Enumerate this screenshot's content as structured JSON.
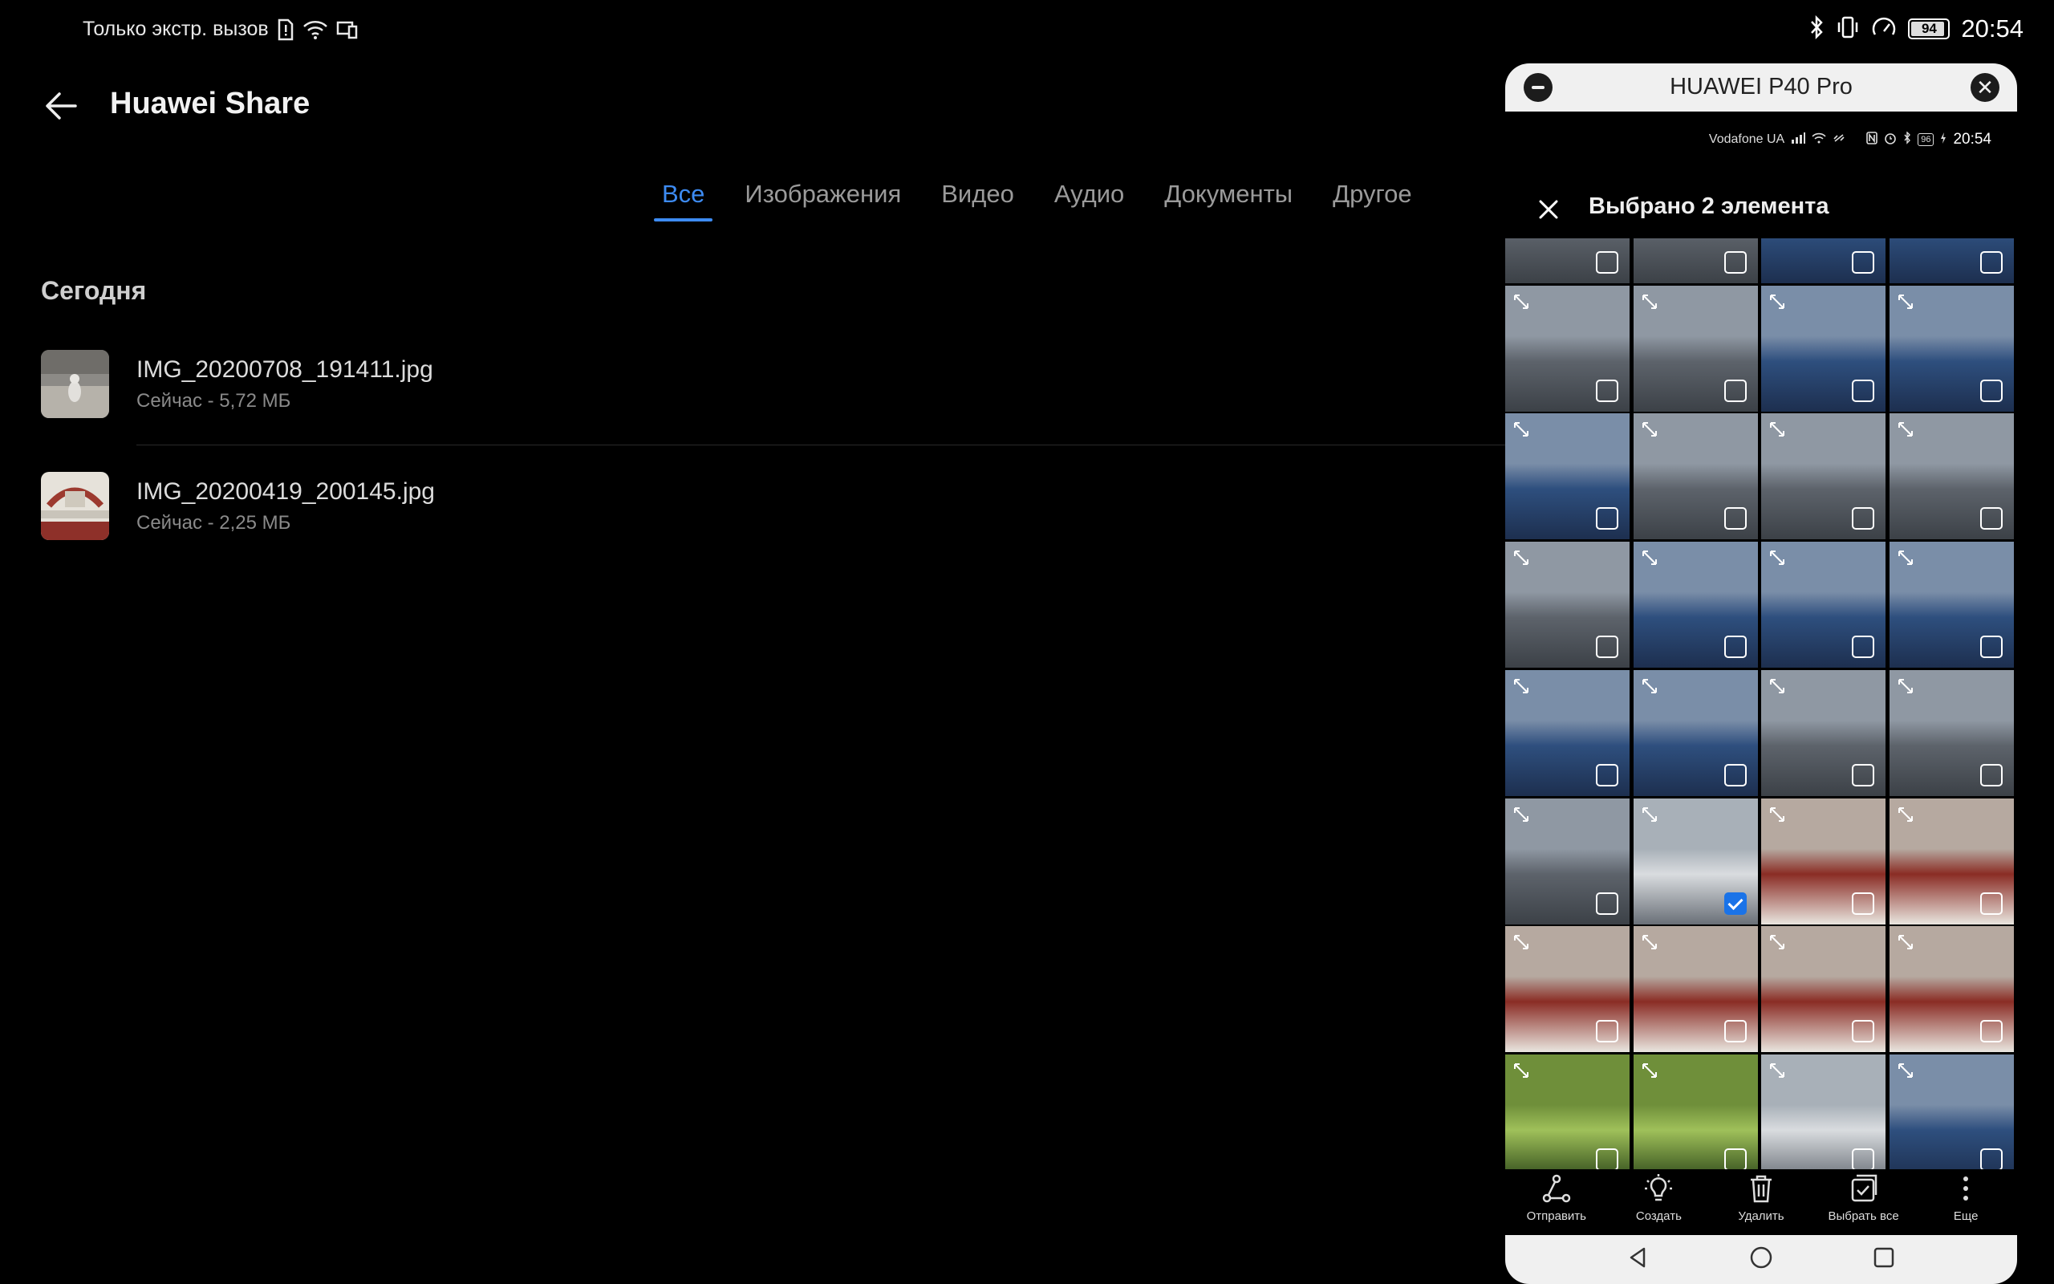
{
  "status_bar": {
    "network_text": "Только экстр. вызов",
    "battery": "94",
    "time": "20:54"
  },
  "header": {
    "title": "Huawei Share"
  },
  "tabs": [
    {
      "label": "Все",
      "active": true
    },
    {
      "label": "Изображения",
      "active": false
    },
    {
      "label": "Видео",
      "active": false
    },
    {
      "label": "Аудио",
      "active": false
    },
    {
      "label": "Документы",
      "active": false
    },
    {
      "label": "Другое",
      "active": false
    }
  ],
  "section": {
    "label": "Сегодня"
  },
  "files": [
    {
      "name": "IMG_20200708_191411.jpg",
      "meta": "Сейчас - 5,72 МБ"
    },
    {
      "name": "IMG_20200419_200145.jpg",
      "meta": "Сейчас - 2,25 МБ"
    }
  ],
  "projection": {
    "title": "HUAWEI P40 Pro",
    "phone_status": {
      "carrier": "Vodafone UA",
      "battery": "96",
      "time": "20:54"
    },
    "selection_title": "Выбрано 2 элемента",
    "actions": [
      {
        "label": "Отправить",
        "icon": "share-icon"
      },
      {
        "label": "Создать",
        "icon": "lightbulb-icon"
      },
      {
        "label": "Удалить",
        "icon": "trash-icon"
      },
      {
        "label": "Выбрать все",
        "icon": "select-all-icon"
      },
      {
        "label": "Еще",
        "icon": "more-icon"
      }
    ],
    "selected_cells": [
      21
    ]
  },
  "colors": {
    "accent": "#3d8bf2",
    "checkbox_selected": "#1a73e8",
    "background": "#000000"
  }
}
